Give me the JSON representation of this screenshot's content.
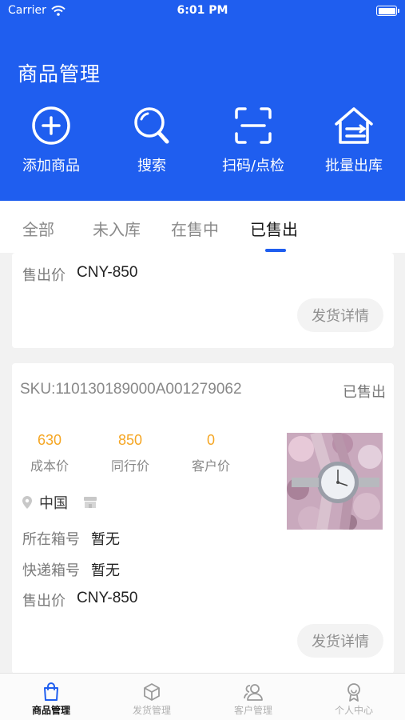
{
  "status_bar": {
    "carrier": "Carrier",
    "time": "6:01 PM"
  },
  "header": {
    "title": "商品管理"
  },
  "actions": [
    {
      "label": "添加商品",
      "icon": "plus-circle-icon"
    },
    {
      "label": "搜索",
      "icon": "search-icon"
    },
    {
      "label": "扫码/点检",
      "icon": "scan-icon"
    },
    {
      "label": "批量出库",
      "icon": "warehouse-out-icon"
    }
  ],
  "tabs": [
    {
      "label": "全部"
    },
    {
      "label": "未入库"
    },
    {
      "label": "在售中"
    },
    {
      "label": "已售出",
      "active": true
    }
  ],
  "cards": [
    {
      "sale_price_label": "售出价",
      "sale_price": "CNY-850",
      "detail_button": "发货详情"
    },
    {
      "sku": "SKU:110130189000A001279062",
      "status": "已售出",
      "prices": [
        {
          "value": "630",
          "label": "成本价"
        },
        {
          "value": "850",
          "label": "同行价"
        },
        {
          "value": "0",
          "label": "客户价"
        }
      ],
      "location": "中国",
      "box_label": "所在箱号",
      "box_value": "暂无",
      "express_label": "快递箱号",
      "express_value": "暂无",
      "sale_price_label": "售出价",
      "sale_price": "CNY-850",
      "detail_button": "发货详情"
    }
  ],
  "bottom_nav": [
    {
      "label": "商品管理",
      "active": true
    },
    {
      "label": "发货管理"
    },
    {
      "label": "客户管理"
    },
    {
      "label": "个人中心"
    }
  ],
  "colors": {
    "primary": "#1f5eef",
    "price": "#f5a623"
  }
}
